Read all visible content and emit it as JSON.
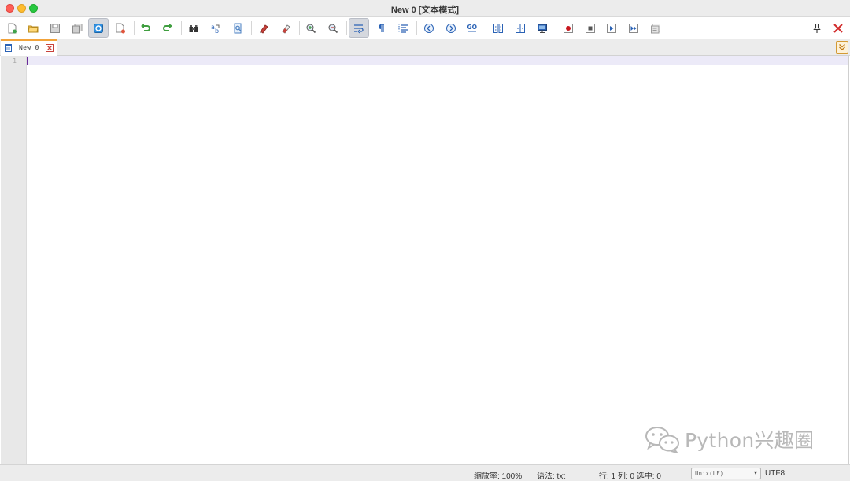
{
  "window": {
    "title": "New 0 [文本模式]"
  },
  "toolbar": {
    "buttons": [
      {
        "name": "new-file-button",
        "icon": "new-file-icon"
      },
      {
        "name": "open-file-button",
        "icon": "open-folder-icon"
      },
      {
        "name": "save-button",
        "icon": "save-icon"
      },
      {
        "name": "save-all-button",
        "icon": "save-all-icon"
      },
      {
        "name": "auto-save-button",
        "icon": "auto-save-icon",
        "active": true
      },
      {
        "name": "close-file-button",
        "icon": "close-file-icon"
      },
      {
        "name": "undo-button",
        "icon": "undo-icon"
      },
      {
        "name": "redo-button",
        "icon": "redo-icon"
      },
      {
        "name": "find-button",
        "icon": "binoculars-icon"
      },
      {
        "name": "replace-button",
        "icon": "replace-icon"
      },
      {
        "name": "find-in-files-button",
        "icon": "find-in-files-icon"
      },
      {
        "name": "marker-button",
        "icon": "marker-icon"
      },
      {
        "name": "clear-marks-button",
        "icon": "eraser-icon"
      },
      {
        "name": "zoom-in-button",
        "icon": "zoom-in-icon"
      },
      {
        "name": "zoom-out-button",
        "icon": "zoom-out-icon"
      },
      {
        "name": "word-wrap-button",
        "icon": "word-wrap-icon",
        "active": true
      },
      {
        "name": "show-all-chars-button",
        "icon": "pilcrow-icon"
      },
      {
        "name": "indent-guide-button",
        "icon": "indent-guide-icon"
      },
      {
        "name": "prev-button",
        "icon": "circle-left-icon"
      },
      {
        "name": "next-button",
        "icon": "circle-right-icon"
      },
      {
        "name": "goto-button",
        "icon": "goto-icon"
      },
      {
        "name": "sync-vertical-button",
        "icon": "sync-vertical-icon"
      },
      {
        "name": "sync-horizontal-button",
        "icon": "sync-horizontal-icon"
      },
      {
        "name": "monitor-button",
        "icon": "monitor-icon"
      },
      {
        "name": "macro-record-button",
        "icon": "record-icon"
      },
      {
        "name": "macro-stop-button",
        "icon": "stop-icon"
      },
      {
        "name": "macro-play-button",
        "icon": "play-icon"
      },
      {
        "name": "macro-run-multiple-button",
        "icon": "fast-forward-icon"
      },
      {
        "name": "macro-save-button",
        "icon": "macro-save-icon"
      }
    ],
    "pin_icon": "pin-icon",
    "close_icon": "close-icon"
  },
  "tabs": [
    {
      "label": "New 0",
      "active": true,
      "accent": "#f2a33a"
    }
  ],
  "editor": {
    "line_numbers": [
      "1"
    ],
    "content": "",
    "current_line_color": "#eceaf8",
    "caret_color": "#6a2c9a"
  },
  "watermark": {
    "text": "Python兴趣圈",
    "icon": "wechat-icon"
  },
  "status": {
    "zoom": "缩放率: 100%",
    "syntax": "语法:  txt",
    "position": "行: 1 列: 0 选中: 0",
    "eol": "Unix(LF)",
    "encoding": "UTF8"
  }
}
